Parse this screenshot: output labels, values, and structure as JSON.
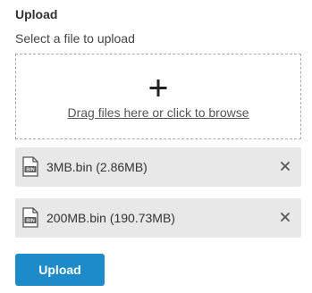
{
  "upload": {
    "title": "Upload",
    "subtitle": "Select a file to upload",
    "dropzone": {
      "icon": "plus-icon",
      "link_text": "Drag files here or click to browse"
    },
    "files": [
      {
        "name": "3MB.bin (2.86MB)",
        "icon": "bin-file-icon",
        "icon_label": "BIN"
      },
      {
        "name": "200MB.bin (190.73MB)",
        "icon": "bin-file-icon",
        "icon_label": "BIN"
      }
    ],
    "upload_button_label": "Upload"
  },
  "colors": {
    "accent": "#1d8ac9",
    "file_item_bg": "#e8e8e8",
    "dropzone_border": "#a8a8a8"
  }
}
